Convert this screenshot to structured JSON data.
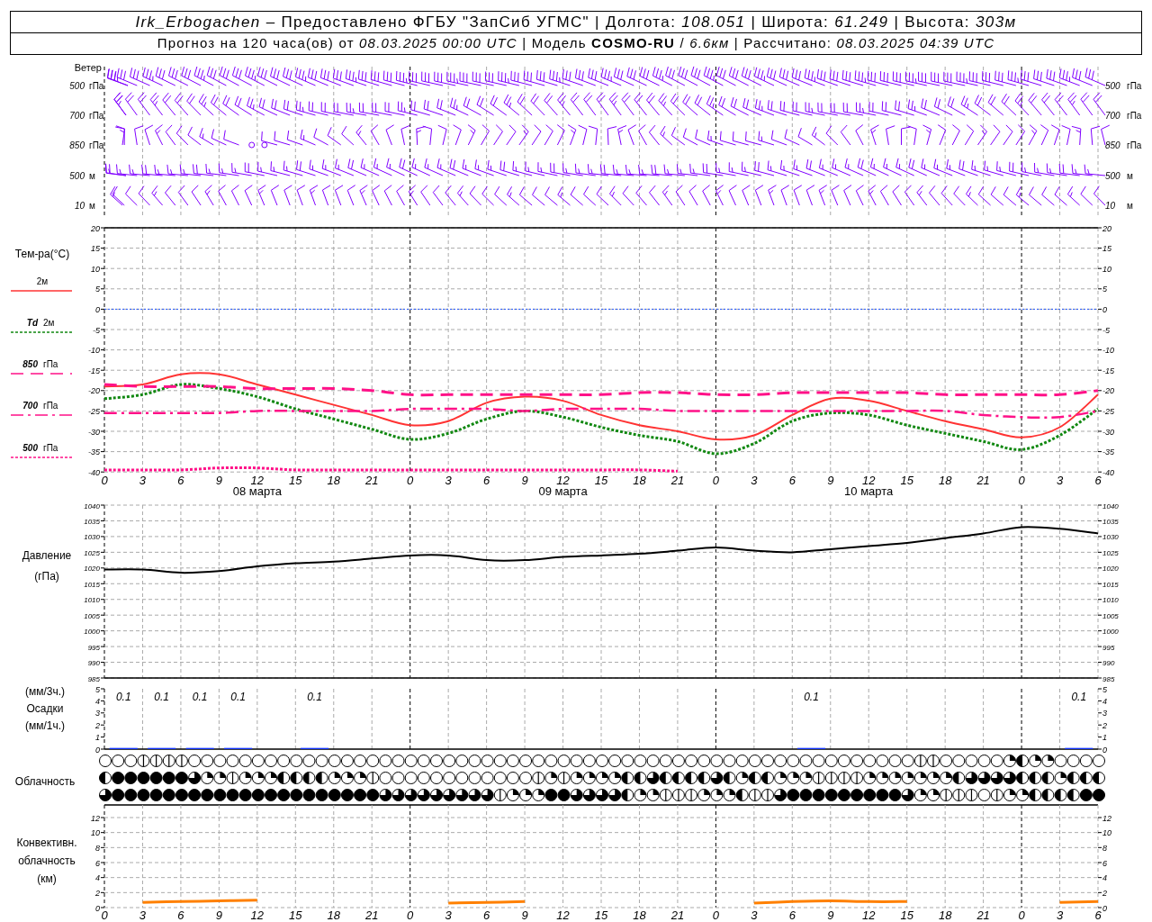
{
  "header": {
    "line_1": "*Irk_Erbogachen* – Предоставлено ФГБУ \"ЗапСиб УГМС\" | Долгота: *108.051* | Широта: *61.249* | Высота: *303м*",
    "line_2": "Прогноз на 120 часа(ов) от *08.03.2025 00:00 UTC* | Модель **COSMO-RU** / *6.6км* | Рассчитано: *08.03.2025 04:39 UTC*"
  },
  "wind": {
    "title": "Ветер",
    "levels": [
      {
        "value": "500",
        "unit": "гПа"
      },
      {
        "value": "700",
        "unit": "гПа"
      },
      {
        "value": "850",
        "unit": "гПа"
      },
      {
        "value": "500",
        "unit": "м"
      },
      {
        "value": "10",
        "unit": "м"
      }
    ],
    "right_levels": [
      {
        "value": "500",
        "unit": "гПа"
      },
      {
        "value": "700",
        "unit": "гПа"
      },
      {
        "value": "850",
        "unit": "гПа"
      },
      {
        "value": "500",
        "unit": "м"
      },
      {
        "value": "10",
        "unit": "м"
      }
    ]
  },
  "temperature": {
    "title": "Тем-ра(°С)",
    "legend": [
      {
        "label": "2м"
      },
      {
        "symbol": "Td",
        "label": "2м"
      },
      {
        "symbol": "850",
        "label": "гПа"
      },
      {
        "symbol": "700",
        "label": "гПа"
      },
      {
        "symbol": "500",
        "label": "гПа"
      }
    ],
    "dates": [
      "08 марта",
      "09 марта",
      "10 марта"
    ],
    "right_ticks": [
      "20",
      "15",
      "10",
      "5",
      "0",
      "-5",
      "-10",
      "-15",
      "-20",
      "-25",
      "-30",
      "-35",
      "-40"
    ],
    "chart_data": {
      "type": "line",
      "grid": true,
      "categories": [
        "0",
        "3",
        "6",
        "9",
        "12",
        "15",
        "18",
        "21",
        "0",
        "3",
        "6",
        "9",
        "12",
        "15",
        "18",
        "21",
        "0",
        "3",
        "6",
        "9",
        "12",
        "15",
        "18",
        "21",
        "0",
        "3",
        "6"
      ],
      "ylim": [
        -40,
        20
      ],
      "yticks": [
        20,
        15,
        10,
        5,
        0,
        -5,
        -10,
        -15,
        -20,
        -25,
        -30,
        -35,
        -40
      ],
      "ref_lines": [
        {
          "axis": "y",
          "value": 0,
          "color": "#2255ff"
        }
      ],
      "series": [
        {
          "line_style": "solid",
          "color": "#ff3333",
          "values": [
            -19,
            -18.5,
            -16,
            -16,
            -18.5,
            -21,
            -23.5,
            -26,
            -28.5,
            -27.5,
            -23,
            -21.5,
            -22.5,
            -26,
            -28.5,
            -30,
            -32,
            -31,
            -26,
            -22,
            -22.5,
            -25,
            -27.5,
            -29.5,
            -31.5,
            -29,
            -21
          ]
        },
        {
          "line_style": "dotted",
          "color": "#118811",
          "values": [
            -22,
            -21,
            -18.5,
            -19.5,
            -21.5,
            -24.5,
            -27,
            -29.5,
            -32,
            -30.5,
            -27,
            -25,
            -26.5,
            -29,
            -31,
            -32.5,
            -35.5,
            -33,
            -27.5,
            -25.5,
            -26,
            -28.5,
            -30.5,
            -32.5,
            -34.5,
            -31,
            -24.5
          ]
        },
        {
          "line_style": "dashed",
          "color": "#ff1188",
          "values": [
            -18.5,
            -19,
            -19,
            -19,
            -19.5,
            -19.5,
            -19.5,
            -20,
            -21,
            -21,
            -21,
            -21,
            -21,
            -21,
            -20.5,
            -20.5,
            -21,
            -21,
            -20.5,
            -20.5,
            -20.5,
            -20.5,
            -21,
            -21,
            -21,
            -21,
            -20
          ]
        },
        {
          "line_style": "dashdot",
          "color": "#ff1188",
          "values": [
            -25.5,
            -25.5,
            -25.5,
            -25.5,
            -25,
            -25,
            -25,
            -25,
            -24.5,
            -24.5,
            -24.5,
            -25,
            -24.5,
            -24.5,
            -24.5,
            -25,
            -25,
            -25,
            -25,
            -25,
            -25,
            -25,
            -25,
            -26,
            -26.5,
            -26.5,
            -25
          ]
        },
        {
          "line_style": "dotted",
          "color": "#ff1188",
          "values": [
            -39.5,
            -39.5,
            -39.5,
            -39,
            -39,
            -39.5,
            -39.5,
            -39.5,
            -39.5,
            -39.5,
            -39.5,
            -39.5,
            -39.5,
            -39.5,
            -39.5,
            -39.8,
            null,
            null,
            null,
            null,
            null,
            null,
            null,
            null,
            null,
            null,
            null
          ]
        }
      ]
    }
  },
  "pressure": {
    "labels": [
      "Давление",
      "(гПа)"
    ],
    "right_ticks": [
      "1040",
      "1035",
      "1030",
      "1025",
      "1020",
      "1015",
      "1010",
      "1005",
      "1000",
      "995",
      "990",
      "985"
    ],
    "chart_data": {
      "type": "line",
      "grid": true,
      "ylim": [
        985,
        1040
      ],
      "yticks": [
        1040,
        1035,
        1030,
        1025,
        1020,
        1015,
        1010,
        1005,
        1000,
        995,
        990,
        985
      ],
      "series": [
        {
          "color": "#000000",
          "values": [
            1019.5,
            1019.5,
            1018.5,
            1019,
            1020.5,
            1021.5,
            1022,
            1023,
            1024,
            1024,
            1022.5,
            1022.5,
            1023.5,
            1024,
            1024.5,
            1025.5,
            1026.5,
            1025.5,
            1025,
            1026,
            1027,
            1028,
            1029.5,
            1031,
            1033,
            1032.5,
            1031
          ]
        }
      ]
    }
  },
  "precipitation": {
    "labels": [
      "(мм/3ч.)",
      "Осадки",
      "(мм/1ч.)"
    ],
    "right_ticks": [
      "5",
      "4",
      "3",
      "2",
      "1",
      "0"
    ],
    "chart_data": {
      "type": "bar",
      "grid": true,
      "ylim": [
        0,
        5
      ],
      "yticks": [
        5,
        4,
        3,
        2,
        1,
        0
      ],
      "color": "#1133ff",
      "values": [
        0.1,
        0.1,
        0.1,
        0.1,
        0,
        0.1,
        0,
        0,
        0,
        0,
        0,
        0,
        0,
        0,
        0,
        0,
        0,
        0,
        0.1,
        0,
        0,
        0,
        0,
        0,
        0,
        0.1
      ]
    },
    "totals": [
      "0.1",
      "0.1",
      "0.1",
      "0.1",
      "0.1",
      "0.1",
      "0.1"
    ]
  },
  "clouds": {
    "label": "Облачность",
    "rows": [
      {
        "symbols": [
          {
            "kind": "clear"
          },
          {
            "kind": "clear"
          },
          {
            "kind": "clear"
          },
          {
            "kind": "line"
          },
          {
            "kind": "line"
          },
          {
            "kind": "line"
          },
          {
            "kind": "line"
          },
          {
            "kind": "clear"
          },
          {
            "kind": "clear"
          },
          {
            "kind": "clear"
          },
          {
            "kind": "clear"
          },
          {
            "kind": "clear"
          },
          {
            "kind": "clear"
          },
          {
            "kind": "clear"
          },
          {
            "kind": "clear"
          },
          {
            "kind": "clear"
          },
          {
            "kind": "clear"
          },
          {
            "kind": "clear"
          },
          {
            "kind": "clear"
          },
          {
            "kind": "clear"
          },
          {
            "kind": "clear"
          },
          {
            "kind": "clear"
          },
          {
            "kind": "clear"
          },
          {
            "kind": "clear"
          },
          {
            "kind": "clear"
          },
          {
            "kind": "clear"
          },
          {
            "kind": "clear"
          },
          {
            "kind": "clear"
          },
          {
            "kind": "clear"
          },
          {
            "kind": "clear"
          },
          {
            "kind": "clear"
          },
          {
            "kind": "clear"
          },
          {
            "kind": "clear"
          },
          {
            "kind": "clear"
          },
          {
            "kind": "clear"
          },
          {
            "kind": "clear"
          },
          {
            "kind": "clear"
          },
          {
            "kind": "clear"
          },
          {
            "kind": "clear"
          },
          {
            "kind": "clear"
          },
          {
            "kind": "clear"
          },
          {
            "kind": "clear"
          },
          {
            "kind": "clear"
          },
          {
            "kind": "clear"
          },
          {
            "kind": "clear"
          },
          {
            "kind": "clear"
          },
          {
            "kind": "clear"
          },
          {
            "kind": "clear"
          },
          {
            "kind": "clear"
          },
          {
            "kind": "clear"
          },
          {
            "kind": "clear"
          },
          {
            "kind": "clear"
          },
          {
            "kind": "clear"
          },
          {
            "kind": "clear"
          },
          {
            "kind": "clear"
          },
          {
            "kind": "clear"
          },
          {
            "kind": "clear"
          },
          {
            "kind": "clear"
          },
          {
            "kind": "clear"
          },
          {
            "kind": "clear"
          },
          {
            "kind": "clear"
          },
          {
            "kind": "clear"
          },
          {
            "kind": "clear"
          },
          {
            "kind": "clear"
          },
          {
            "kind": "line"
          },
          {
            "kind": "line"
          },
          {
            "kind": "clear"
          },
          {
            "kind": "clear"
          },
          {
            "kind": "clear"
          },
          {
            "kind": "clear"
          },
          {
            "kind": "clear"
          },
          {
            "kind": "quarter"
          },
          {
            "kind": "half"
          },
          {
            "kind": "quarter"
          },
          {
            "kind": "quarter"
          },
          {
            "kind": "clear"
          },
          {
            "kind": "clear"
          },
          {
            "kind": "clear"
          },
          {
            "kind": "clear"
          }
        ]
      },
      {
        "symbols": [
          {
            "kind": "half"
          },
          {
            "kind": "full"
          },
          {
            "kind": "full"
          },
          {
            "kind": "full"
          },
          {
            "kind": "full"
          },
          {
            "kind": "full"
          },
          {
            "kind": "full"
          },
          {
            "kind": "most"
          },
          {
            "kind": "quarter"
          },
          {
            "kind": "quarter"
          },
          {
            "kind": "line"
          },
          {
            "kind": "quarter"
          },
          {
            "kind": "quarter"
          },
          {
            "kind": "quarter"
          },
          {
            "kind": "half"
          },
          {
            "kind": "half"
          },
          {
            "kind": "half"
          },
          {
            "kind": "half"
          },
          {
            "kind": "quarter"
          },
          {
            "kind": "quarter"
          },
          {
            "kind": "quarter"
          },
          {
            "kind": "line"
          },
          {
            "kind": "clear"
          },
          {
            "kind": "clear"
          },
          {
            "kind": "clear"
          },
          {
            "kind": "clear"
          },
          {
            "kind": "clear"
          },
          {
            "kind": "clear"
          },
          {
            "kind": "clear"
          },
          {
            "kind": "clear"
          },
          {
            "kind": "clear"
          },
          {
            "kind": "clear"
          },
          {
            "kind": "clear"
          },
          {
            "kind": "clear"
          },
          {
            "kind": "line"
          },
          {
            "kind": "quarter"
          },
          {
            "kind": "line"
          },
          {
            "kind": "quarter"
          },
          {
            "kind": "quarter"
          },
          {
            "kind": "quarter"
          },
          {
            "kind": "quarter"
          },
          {
            "kind": "half"
          },
          {
            "kind": "half"
          },
          {
            "kind": "most"
          },
          {
            "kind": "half"
          },
          {
            "kind": "half"
          },
          {
            "kind": "half"
          },
          {
            "kind": "half"
          },
          {
            "kind": "most"
          },
          {
            "kind": "half"
          },
          {
            "kind": "quarter"
          },
          {
            "kind": "half"
          },
          {
            "kind": "half"
          },
          {
            "kind": "quarter"
          },
          {
            "kind": "quarter"
          },
          {
            "kind": "quarter"
          },
          {
            "kind": "line"
          },
          {
            "kind": "line"
          },
          {
            "kind": "line"
          },
          {
            "kind": "line"
          },
          {
            "kind": "quarter"
          },
          {
            "kind": "quarter"
          },
          {
            "kind": "quarter"
          },
          {
            "kind": "quarter"
          },
          {
            "kind": "quarter"
          },
          {
            "kind": "quarter"
          },
          {
            "kind": "quarter"
          },
          {
            "kind": "half"
          },
          {
            "kind": "most"
          },
          {
            "kind": "most"
          },
          {
            "kind": "most"
          },
          {
            "kind": "most"
          },
          {
            "kind": "half"
          },
          {
            "kind": "half"
          },
          {
            "kind": "half"
          },
          {
            "kind": "quarter"
          },
          {
            "kind": "half"
          },
          {
            "kind": "half"
          },
          {
            "kind": "half"
          }
        ]
      },
      {
        "symbols": [
          {
            "kind": "most"
          },
          {
            "kind": "full"
          },
          {
            "kind": "full"
          },
          {
            "kind": "full"
          },
          {
            "kind": "full"
          },
          {
            "kind": "full"
          },
          {
            "kind": "full"
          },
          {
            "kind": "full"
          },
          {
            "kind": "full"
          },
          {
            "kind": "full"
          },
          {
            "kind": "full"
          },
          {
            "kind": "full"
          },
          {
            "kind": "full"
          },
          {
            "kind": "full"
          },
          {
            "kind": "full"
          },
          {
            "kind": "full"
          },
          {
            "kind": "full"
          },
          {
            "kind": "full"
          },
          {
            "kind": "full"
          },
          {
            "kind": "full"
          },
          {
            "kind": "full"
          },
          {
            "kind": "full"
          },
          {
            "kind": "most"
          },
          {
            "kind": "most"
          },
          {
            "kind": "most"
          },
          {
            "kind": "most"
          },
          {
            "kind": "most"
          },
          {
            "kind": "most"
          },
          {
            "kind": "most"
          },
          {
            "kind": "most"
          },
          {
            "kind": "most"
          },
          {
            "kind": "line"
          },
          {
            "kind": "quarter"
          },
          {
            "kind": "quarter"
          },
          {
            "kind": "quarter"
          },
          {
            "kind": "full"
          },
          {
            "kind": "full"
          },
          {
            "kind": "most"
          },
          {
            "kind": "most"
          },
          {
            "kind": "most"
          },
          {
            "kind": "most"
          },
          {
            "kind": "half"
          },
          {
            "kind": "quarter"
          },
          {
            "kind": "quarter"
          },
          {
            "kind": "line"
          },
          {
            "kind": "line"
          },
          {
            "kind": "line"
          },
          {
            "kind": "quarter"
          },
          {
            "kind": "quarter"
          },
          {
            "kind": "quarter"
          },
          {
            "kind": "half"
          },
          {
            "kind": "line"
          },
          {
            "kind": "line"
          },
          {
            "kind": "most"
          },
          {
            "kind": "full"
          },
          {
            "kind": "full"
          },
          {
            "kind": "full"
          },
          {
            "kind": "full"
          },
          {
            "kind": "full"
          },
          {
            "kind": "full"
          },
          {
            "kind": "full"
          },
          {
            "kind": "full"
          },
          {
            "kind": "full"
          },
          {
            "kind": "most"
          },
          {
            "kind": "quarter"
          },
          {
            "kind": "quarter"
          },
          {
            "kind": "line"
          },
          {
            "kind": "line"
          },
          {
            "kind": "line"
          },
          {
            "kind": "clear"
          },
          {
            "kind": "line"
          },
          {
            "kind": "quarter"
          },
          {
            "kind": "quarter"
          },
          {
            "kind": "half"
          },
          {
            "kind": "half"
          },
          {
            "kind": "half"
          },
          {
            "kind": "half"
          },
          {
            "kind": "full"
          },
          {
            "kind": "full"
          }
        ]
      }
    ]
  },
  "convective": {
    "labels": [
      "Конвективн.",
      "облачность",
      "(км)"
    ],
    "right_ticks": [
      "12",
      "10",
      "8",
      "6",
      "4",
      "2",
      "0"
    ],
    "chart_data": {
      "type": "line",
      "grid": true,
      "categories": [
        "0",
        "3",
        "6",
        "9",
        "12",
        "15",
        "18",
        "21",
        "0",
        "3",
        "6",
        "9",
        "12",
        "15",
        "18",
        "21",
        "0",
        "3",
        "6",
        "9",
        "12",
        "15",
        "18",
        "21",
        "0",
        "3",
        "6"
      ],
      "ylim": [
        0,
        12
      ],
      "yticks": [
        12,
        10,
        8,
        6,
        4,
        2,
        0
      ],
      "series": [
        {
          "color": "#ff8000",
          "values": [
            null,
            0.7,
            0.8,
            0.9,
            1.0,
            null,
            null,
            null,
            null,
            0.6,
            0.7,
            0.8,
            null,
            null,
            null,
            null,
            null,
            0.6,
            0.8,
            0.9,
            0.8,
            0.8,
            null,
            null,
            null,
            0.7,
            0.8
          ]
        }
      ]
    }
  }
}
